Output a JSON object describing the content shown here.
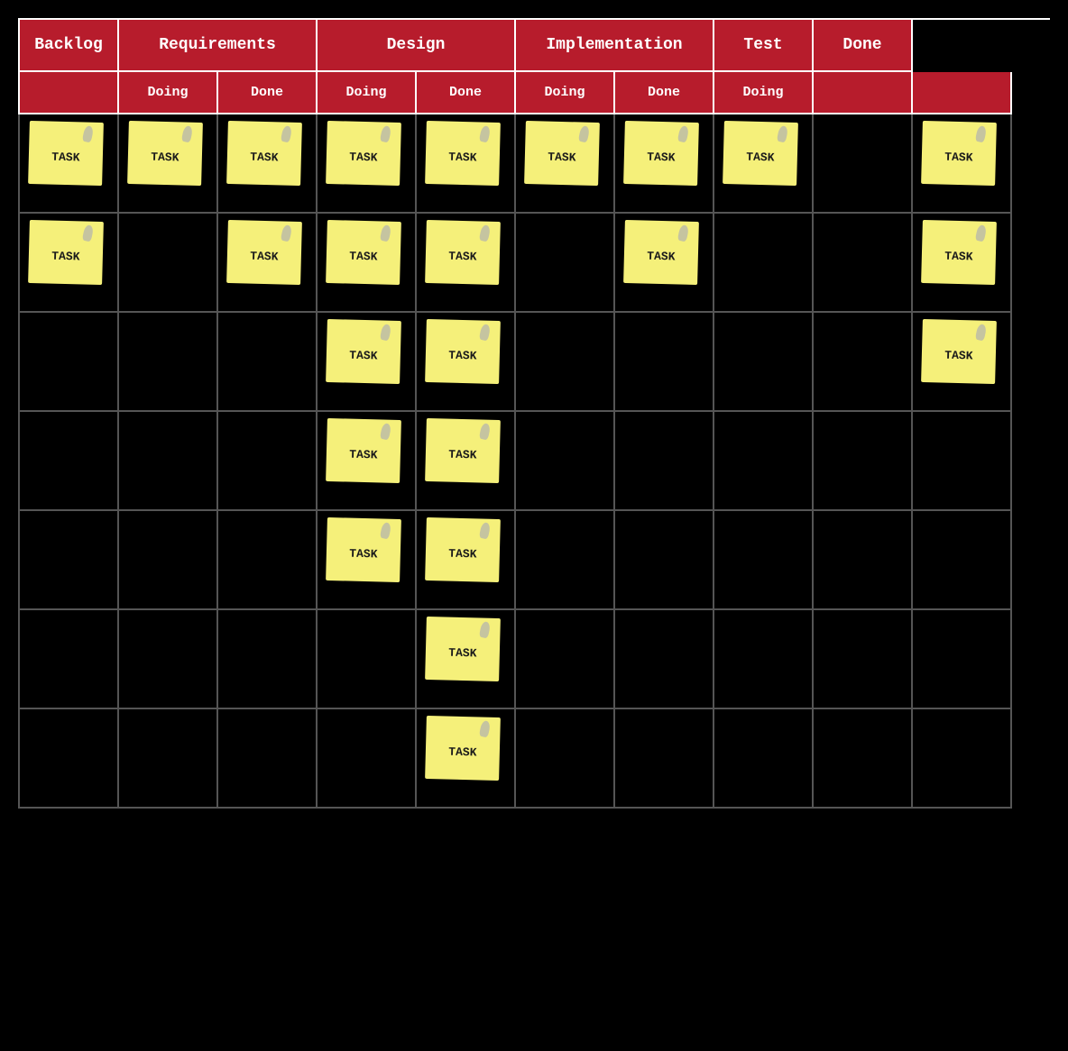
{
  "header": {
    "top_columns": [
      {
        "label": "Backlog",
        "span": 1
      },
      {
        "label": "Requirements",
        "span": 2
      },
      {
        "label": "Design",
        "span": 2
      },
      {
        "label": "Implementation",
        "span": 2
      },
      {
        "label": "Test",
        "span": 1
      },
      {
        "label": "Done",
        "span": 1
      }
    ],
    "sub_columns": [
      {
        "label": "",
        "empty": true
      },
      {
        "label": "Doing"
      },
      {
        "label": "Done"
      },
      {
        "label": "Doing"
      },
      {
        "label": "Done"
      },
      {
        "label": "Doing"
      },
      {
        "label": "Done"
      },
      {
        "label": "Doing"
      },
      {
        "label": ""
      },
      {
        "label": ""
      }
    ]
  },
  "task_label": "TASK",
  "colors": {
    "header_bg": "#b71c2c",
    "header_text": "#ffffff",
    "sticky_bg": "#f5f07a",
    "board_bg": "#000000",
    "grid_line": "#555555"
  },
  "rows": [
    [
      true,
      true,
      true,
      true,
      true,
      true,
      true,
      true,
      false,
      true
    ],
    [
      true,
      false,
      true,
      true,
      true,
      false,
      true,
      false,
      false,
      true
    ],
    [
      false,
      false,
      false,
      true,
      true,
      false,
      false,
      false,
      false,
      true
    ],
    [
      false,
      false,
      false,
      true,
      true,
      false,
      false,
      false,
      false,
      false
    ],
    [
      false,
      false,
      false,
      true,
      true,
      false,
      false,
      false,
      false,
      false
    ],
    [
      false,
      false,
      false,
      false,
      true,
      false,
      false,
      false,
      false,
      false
    ],
    [
      false,
      false,
      false,
      false,
      true,
      false,
      false,
      false,
      false,
      false
    ]
  ]
}
